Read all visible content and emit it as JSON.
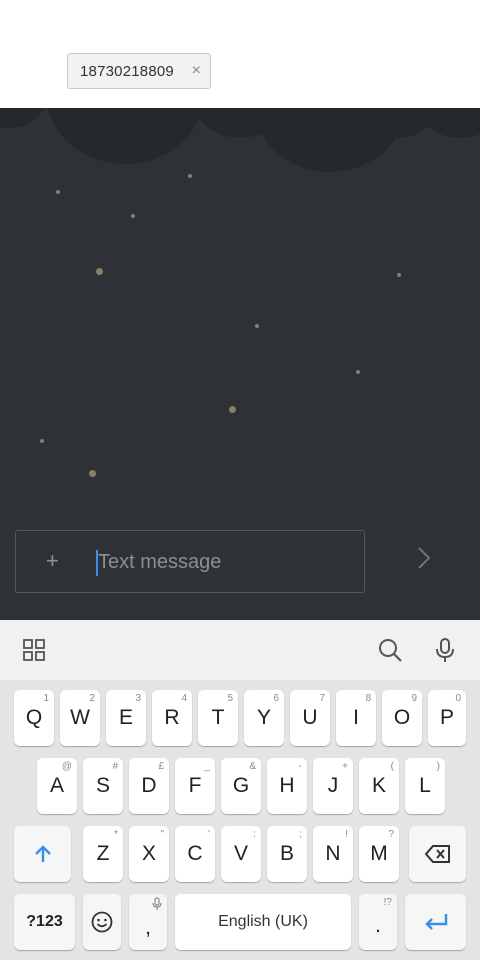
{
  "recipient": {
    "number": "18730218809",
    "remove_icon": "close-icon"
  },
  "compose": {
    "attach_icon": "plus-icon",
    "placeholder": "Text message",
    "send_icon": "chevron-right-icon"
  },
  "keyboard_toolbar": {
    "menu_icon": "grid-icon",
    "search_icon": "search-icon",
    "voice_icon": "microphone-icon"
  },
  "keyboard": {
    "row1": [
      {
        "key": "Q",
        "hint": "1"
      },
      {
        "key": "W",
        "hint": "2"
      },
      {
        "key": "E",
        "hint": "3"
      },
      {
        "key": "R",
        "hint": "4"
      },
      {
        "key": "T",
        "hint": "5"
      },
      {
        "key": "Y",
        "hint": "6"
      },
      {
        "key": "U",
        "hint": "7"
      },
      {
        "key": "I",
        "hint": "8"
      },
      {
        "key": "O",
        "hint": "9"
      },
      {
        "key": "P",
        "hint": "0"
      }
    ],
    "row2": [
      {
        "key": "A",
        "hint": "@"
      },
      {
        "key": "S",
        "hint": "#"
      },
      {
        "key": "D",
        "hint": "£"
      },
      {
        "key": "F",
        "hint": "_"
      },
      {
        "key": "G",
        "hint": "&"
      },
      {
        "key": "H",
        "hint": "-"
      },
      {
        "key": "J",
        "hint": "+"
      },
      {
        "key": "K",
        "hint": "("
      },
      {
        "key": "L",
        "hint": ")"
      }
    ],
    "row3": [
      {
        "key": "Z",
        "hint": "*"
      },
      {
        "key": "X",
        "hint": "\""
      },
      {
        "key": "C",
        "hint": "'"
      },
      {
        "key": "V",
        "hint": ":"
      },
      {
        "key": "B",
        "hint": ";"
      },
      {
        "key": "N",
        "hint": "!"
      },
      {
        "key": "M",
        "hint": "?"
      }
    ],
    "shift_icon": "shift-arrow-icon",
    "backspace_icon": "backspace-icon",
    "symbols_label": "?123",
    "emoji_icon": "smiley-icon",
    "comma_label": ",",
    "comma_hint_icon": "microphone-icon",
    "space_label": "English (UK)",
    "period_label": ".",
    "period_hint": "!?",
    "enter_icon": "enter-arrow-icon"
  },
  "colors": {
    "accent": "#3a8ee6",
    "conversation_bg": "#2e3135",
    "keyboard_bg": "#e3e4e6"
  }
}
